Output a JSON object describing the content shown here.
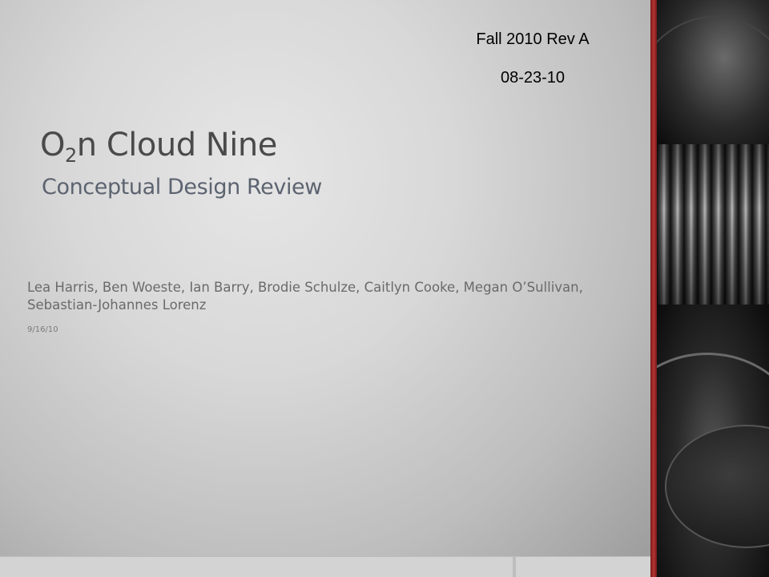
{
  "header": {
    "revision": "Fall 2010 Rev A",
    "date": "08-23-10"
  },
  "title": {
    "prefix": "O",
    "subscript": "2",
    "suffix": "n Cloud Nine"
  },
  "subtitle": "Conceptual Design Review",
  "authors": "Lea Harris, Ben Woeste, Ian Barry, Brodie Schulze, Caitlyn Cooke, Megan O’Sullivan, Sebastian-Johannes Lorenz",
  "date": "9/16/10",
  "colors": {
    "accent": "#b33333",
    "title": "#4a4a4a",
    "subtitle": "#5c6370"
  }
}
